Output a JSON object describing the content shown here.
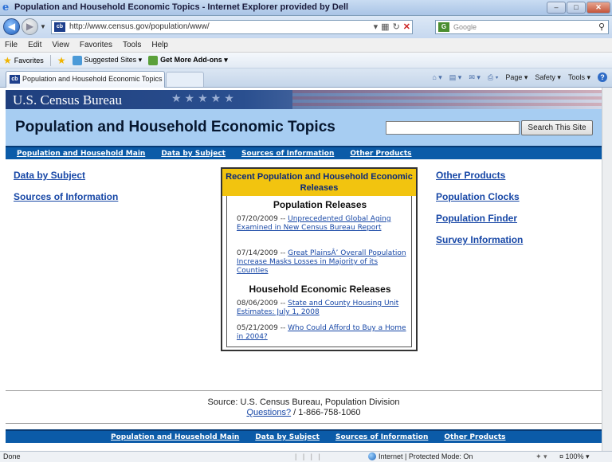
{
  "browser": {
    "window_title": "Population and Household Economic Topics - Internet Explorer provided by Dell",
    "url": "http://www.census.gov/population/www/",
    "search_placeholder": "Google",
    "menu": [
      "File",
      "Edit",
      "View",
      "Favorites",
      "Tools",
      "Help"
    ],
    "favorites": {
      "favorites_label": "Favorites",
      "suggested": "Suggested Sites ▾",
      "addons": "Get More Add-ons ▾"
    },
    "tab_label": "Population and Household Economic Topics",
    "command_bar": {
      "page": "Page ▾",
      "safety": "Safety ▾",
      "tools": "Tools ▾"
    },
    "status": {
      "done": "Done",
      "zone": "Internet | Protected Mode: On",
      "zoom": "¤ 100% ▾"
    }
  },
  "page": {
    "agency": "U.S. Census Bureau",
    "title": "Population and Household Economic Topics",
    "search_button": "Search This Site",
    "nav": [
      "Population and Household Main",
      "Data by Subject",
      "Sources of Information",
      "Other Products"
    ],
    "left_links": [
      "Data by Subject",
      "Sources of Information"
    ],
    "right_links": [
      "Other Products",
      "Population Clocks",
      "Population Finder",
      "Survey Information"
    ],
    "releases_box": {
      "title": "Recent Population and Household Economic Releases",
      "population_heading": "Population Releases",
      "population": [
        {
          "date": "07/20/2009 --",
          "title": "Unprecedented Global Aging Examined in New Census Bureau Report"
        },
        {
          "date": "07/14/2009 --",
          "title": "Great PlainsÂ’ Overall Population Increase Masks Losses in Majority of its Counties"
        }
      ],
      "household_heading": "Household Economic Releases",
      "household": [
        {
          "date": "08/06/2009 --",
          "title": "State and County Housing Unit Estimates: July 1, 2008"
        },
        {
          "date": "05/21/2009 --",
          "title": "Who Could Afford to Buy a Home in 2004?"
        }
      ]
    },
    "footer": {
      "source": "Source: U.S. Census Bureau, Population Division",
      "questions": "Questions?",
      "phone": " / 1-866-758-1060"
    }
  },
  "colors": {
    "nav_bar": "#0b5ba8",
    "header_band": "#a7cdf2",
    "release_title": "#f2c40f",
    "link": "#1747a6"
  }
}
